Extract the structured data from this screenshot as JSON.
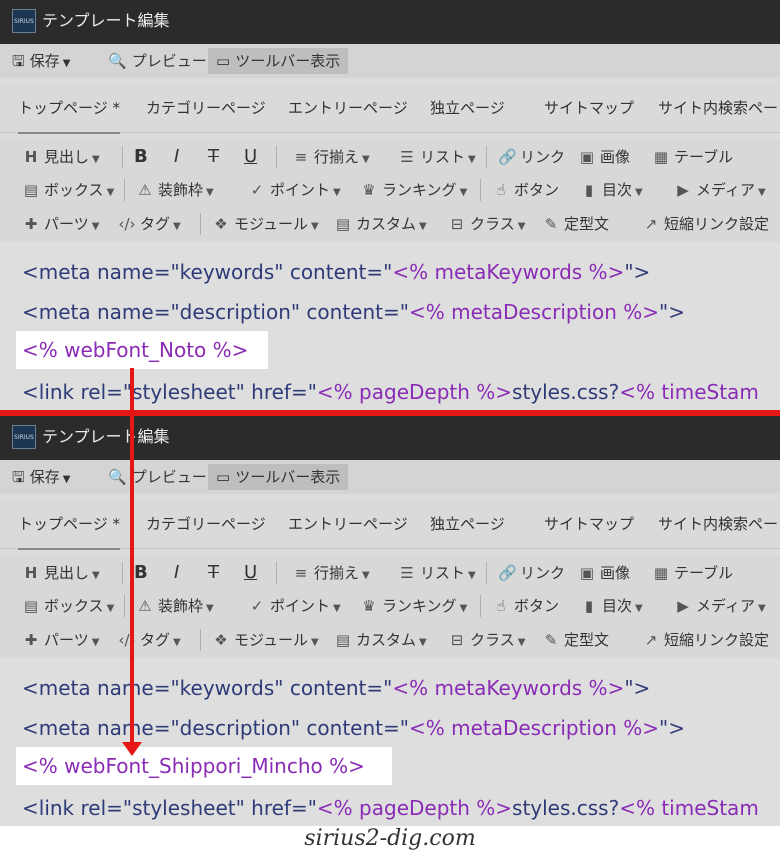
{
  "app": {
    "logo_text": "SIRIUS",
    "title": "テンプレート編集"
  },
  "menubar": {
    "save": "保存",
    "preview": "プレビュー",
    "toolbar_toggle": "ツールバー表示"
  },
  "tabs": [
    "トップページ *",
    "カテゴリーページ",
    "エントリーページ",
    "独立ページ",
    "サイトマップ",
    "サイト内検索ペー"
  ],
  "toolbar": {
    "row1": {
      "heading": "見出し",
      "bold": "B",
      "italic": "I",
      "strike": "T",
      "underline": "U",
      "align": "行揃え",
      "list": "リスト",
      "link": "リンク",
      "image": "画像",
      "table": "テーブル"
    },
    "row2": {
      "box": "ボックス",
      "decor_frame": "装飾枠",
      "point": "ポイント",
      "ranking": "ランキング",
      "button": "ボタン",
      "toc": "目次",
      "media": "メディア"
    },
    "row3": {
      "parts": "パーツ",
      "tag": "タグ",
      "module": "モジュール",
      "custom": "カスタム",
      "class": "クラス",
      "fixed_text": "定型文",
      "short_link": "短縮リンク設定"
    }
  },
  "editor": {
    "before": {
      "line1": {
        "open": "<meta name=\"keywords\" content=\"",
        "var": "<% metaKeywords %>",
        "close": "\">"
      },
      "line2": {
        "open": "<meta name=\"description\" content=\"",
        "var": "<% metaDescription %>",
        "close": "\">"
      },
      "line3": "<% webFont_Noto %>",
      "line4": {
        "open": "<link rel=\"stylesheet\" href=\"",
        "var": "<% pageDepth %>",
        "mid": "styles.css?",
        "var2": "<% timeStam"
      }
    },
    "after": {
      "line1": {
        "open": "<meta name=\"keywords\" content=\"",
        "var": "<% metaKeywords %>",
        "close": "\">"
      },
      "line2": {
        "open": "<meta name=\"description\" content=\"",
        "var": "<% metaDescription %>",
        "close": "\">"
      },
      "line3": "<% webFont_Shippori_Mincho %>",
      "line4": {
        "open": "<link rel=\"stylesheet\" href=\"",
        "var": "<% pageDepth %>",
        "mid": "styles.css?",
        "var2": "<% timeStam"
      }
    }
  },
  "watermark": "sirius2-dig.com",
  "colors": {
    "arrow": "#e41616",
    "template_var": "#8a2bb5",
    "tag": "#2f3a78",
    "titlebar": "#2b2b2b"
  }
}
